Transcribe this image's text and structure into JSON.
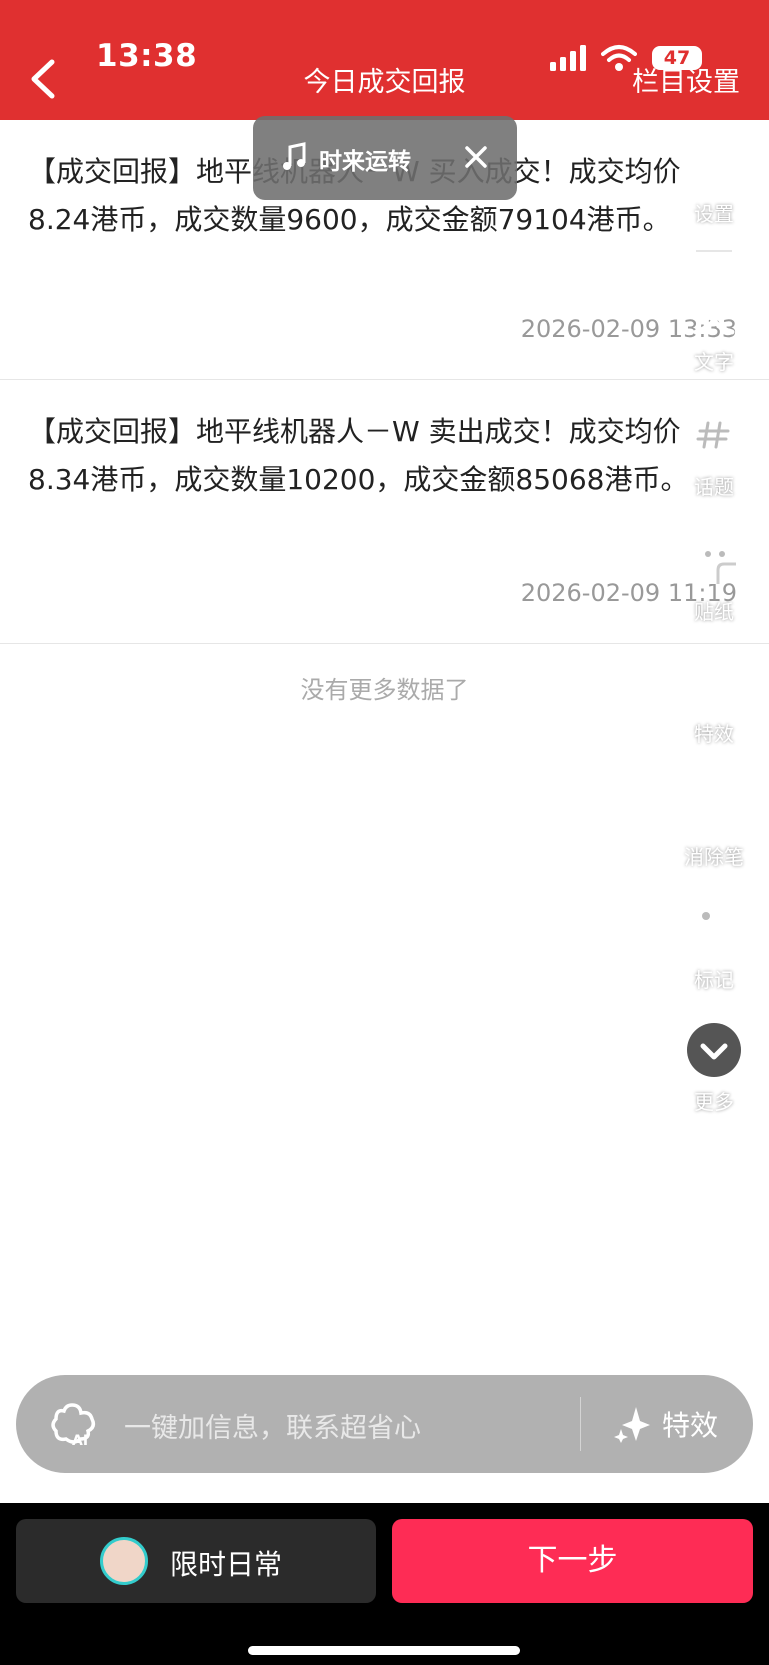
{
  "status_bar": {
    "time": "13:38",
    "battery": "47"
  },
  "header": {
    "title": "今日成交回报",
    "column_settings": "栏目设置"
  },
  "music": {
    "label": "时来运转"
  },
  "items": [
    {
      "text": "【成交回报】地平线机器人－W 买入成交！成交均价 8.24港币，成交数量9600，成交金额79104港币。",
      "date": "2026-02-09 13:33"
    },
    {
      "text": "【成交回报】地平线机器人－W 卖出成交！成交均价 8.34港币，成交数量10200，成交金额85068港币。",
      "date": "2026-02-09 11:19"
    }
  ],
  "no_more": "没有更多数据了",
  "tools": {
    "settings": "设置",
    "text": "文字",
    "topic": "话题",
    "sticker": "贴纸",
    "effects": "特效",
    "eraser": "消除笔",
    "mark": "标记",
    "more": "更多"
  },
  "input_bar": {
    "placeholder": "一键加信息，联系超省心",
    "effects_label": "特效"
  },
  "dock": {
    "daily_label": "限时日常",
    "next_label": "下一步"
  },
  "colors": {
    "header_red": "#e03030",
    "next_pink": "#fe2c55"
  }
}
